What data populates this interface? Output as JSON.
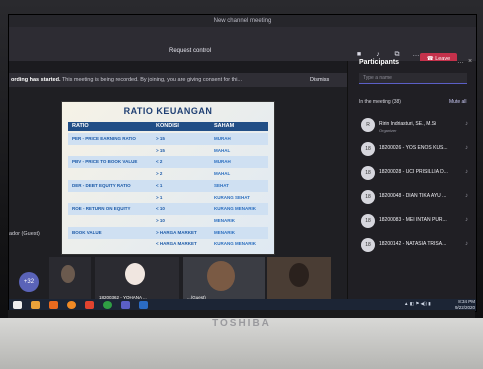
{
  "window": {
    "title": "New channel meeting",
    "request_control": "Request control",
    "leave_label": "Leave"
  },
  "recording": {
    "message_bold": "ording has started.",
    "message_rest": " This meeting is being recorded. By joining, you are giving consent for thi...",
    "dismiss_label": "Dismiss"
  },
  "slide": {
    "title": "RATIO KEUANGAN",
    "headers": [
      "RATIO",
      "KONDISI",
      "SAHAM"
    ],
    "rows": [
      {
        "ratio": "PER - PRICE EARNING RATIO",
        "kondisi": "> 15",
        "saham": "MURAH"
      },
      {
        "ratio": "",
        "kondisi": "> 15",
        "saham": "MAHAL"
      },
      {
        "ratio": "PBV - PRICE TO BOOK VALUE",
        "kondisi": "< 2",
        "saham": "MURAH"
      },
      {
        "ratio": "",
        "kondisi": "> 2",
        "saham": "MAHAL"
      },
      {
        "ratio": "DER - DEBT EQUITY RATIO",
        "kondisi": "< 1",
        "saham": "SEHAT"
      },
      {
        "ratio": "",
        "kondisi": "> 1",
        "saham": "KURANG SEHAT"
      },
      {
        "ratio": "ROE - RETURN ON EQUITY",
        "kondisi": "< 10",
        "saham": "KURANG MENARIK"
      },
      {
        "ratio": "",
        "kondisi": "> 10",
        "saham": "MENARIK"
      },
      {
        "ratio": "BOOK VALUE",
        "kondisi": "> HARGA MARKET",
        "saham": "MENARIK"
      },
      {
        "ratio": "",
        "kondisi": "< HARGA MARKET",
        "saham": "KURANG MENARIK"
      }
    ]
  },
  "stage": {
    "external_label": "ador (Guest)"
  },
  "strip": {
    "overflow_count": "+32",
    "tiles": [
      {
        "label": ""
      },
      {
        "label": "18200362 - YOHANA ..."
      },
      {
        "label": "...(Guest)"
      },
      {
        "label": ""
      }
    ]
  },
  "participants": {
    "title": "Participants",
    "search_placeholder": "Type a name",
    "in_meeting_label": "In the meeting (38)",
    "mute_all_label": "Mute all",
    "list": [
      {
        "initials": "R",
        "name": "Ririn Indriasturi, SE., M.Si",
        "role": "Organizer"
      },
      {
        "initials": "18",
        "name": "18200026 - YOS ENOS KUS...",
        "role": ""
      },
      {
        "initials": "18",
        "name": "18200028 - UCI PRISILLIA D...",
        "role": ""
      },
      {
        "initials": "18",
        "name": "18200048 - DIAN TIKA AYU ...",
        "role": ""
      },
      {
        "initials": "18",
        "name": "18200083 - MEI INTAN PUR...",
        "role": ""
      },
      {
        "initials": "18",
        "name": "18200142 - NATASIA TRISA...",
        "role": ""
      }
    ]
  },
  "taskbar": {
    "time": "8:34 PM",
    "date": "9/22/2020"
  },
  "laptop": {
    "brand": "TOSHIBA"
  },
  "colors": {
    "leave": "#c4314b",
    "accent": "#5b5fc7",
    "slide_header": "#214e86",
    "slide_title": "#1f3f73"
  }
}
